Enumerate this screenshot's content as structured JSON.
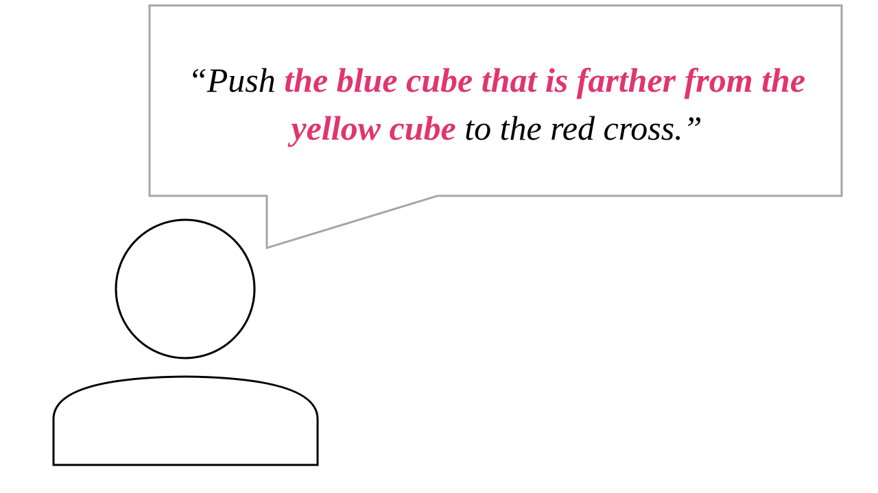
{
  "speech": {
    "open_quote": "“",
    "part1": "Push ",
    "highlight": "the blue cube that is farther from the yellow cube",
    "part2": " to the red cross.",
    "close_quote": "”"
  },
  "colors": {
    "highlight": "#e0356f",
    "text": "#000000",
    "bubble_border": "#a6a6a6",
    "person_outline": "#000000"
  },
  "icons": {
    "speaker": "person-icon"
  }
}
